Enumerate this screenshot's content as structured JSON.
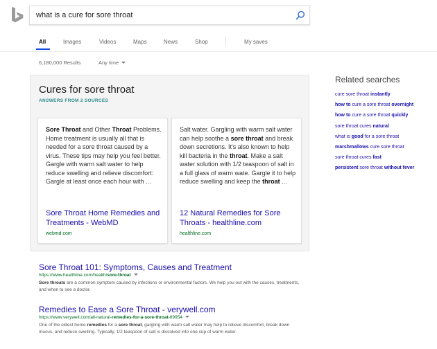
{
  "search": {
    "query": "what is a cure for sore throat"
  },
  "nav": {
    "tabs": [
      {
        "label": "All",
        "active": true
      },
      {
        "label": "Images"
      },
      {
        "label": "Videos"
      },
      {
        "label": "Maps"
      },
      {
        "label": "News"
      },
      {
        "label": "Shop"
      },
      {
        "label": "My saves"
      }
    ]
  },
  "filters": {
    "results_count": "6,180,000 Results",
    "time_filter": "Any time"
  },
  "answer": {
    "title": "Cures for sore throat",
    "sources_label": "ANSWERS FROM 2 SOURCES",
    "cards": [
      {
        "snippet_parts": [
          {
            "text": "Sore Throat",
            "bold": true
          },
          {
            "text": " and Other "
          },
          {
            "text": "Throat",
            "bold": true
          },
          {
            "text": " Problems. Home treatment is usually all that is needed for a sore throat caused by a virus. These tips may help you feel better. Gargle with warm salt water to help reduce swelling and relieve discomfort: Gargle at least once each hour with ..."
          }
        ],
        "title": "Sore Throat Home Remedies and Treatments - WebMD",
        "domain": "webmd.com"
      },
      {
        "snippet_parts": [
          {
            "text": "Salt water. Gargling with warm salt water can help soothe a "
          },
          {
            "text": "sore throat",
            "bold": true
          },
          {
            "text": " and break down secretions. It's also known to help kill bacteria in the "
          },
          {
            "text": "throat",
            "bold": true
          },
          {
            "text": ". Make a salt water solution with 1/2 teaspoon of salt in a full glass of warm wate. Gargle it to help reduce swelling and keep the "
          },
          {
            "text": "throat",
            "bold": true
          },
          {
            "text": " ..."
          }
        ],
        "title": "12 Natural Remedies for Sore Throats - healthline.com",
        "domain": "healthline.com"
      }
    ]
  },
  "results": [
    {
      "title": "Sore Throat 101: Symptoms, Causes and Treatment",
      "url_parts": [
        {
          "text": "https://www.healthline.com/health/"
        },
        {
          "text": "sore-throat",
          "bold": true
        }
      ],
      "snippet_parts": [
        {
          "text": "Sore throats",
          "bold": true
        },
        {
          "text": " are a common symptom caused by infections or environmental factors. We help you out with the causes, treatments, and when to see a doctor."
        }
      ]
    },
    {
      "title": "Remedies to Ease a Sore Throat - verywell.com",
      "url_parts": [
        {
          "text": "https://www.verywell.com/all-natural-"
        },
        {
          "text": "remedies-for-a-sore-throat",
          "bold": true
        },
        {
          "text": "-89954"
        }
      ],
      "snippet_parts": [
        {
          "text": "One of the oldest home "
        },
        {
          "text": "remedies",
          "bold": true
        },
        {
          "text": " for a "
        },
        {
          "text": "sore throat",
          "bold": true
        },
        {
          "text": ", gargling with warm salt water may help to relieve discomfort, break down mucus, and reduce swelling. Typically, 1/2 teaspoon of salt is dissolved into one cup of warm water."
        }
      ]
    }
  ],
  "related": {
    "heading": "Related searches",
    "items": [
      [
        {
          "text": "cure sore throat "
        },
        {
          "text": "instantly",
          "bold": true
        }
      ],
      [
        {
          "text": "how to",
          "bold": true
        },
        {
          "text": " cure a sore throat "
        },
        {
          "text": "overnight",
          "bold": true
        }
      ],
      [
        {
          "text": "how to",
          "bold": true
        },
        {
          "text": " cure a sore throat "
        },
        {
          "text": "quickly",
          "bold": true
        }
      ],
      [
        {
          "text": "sore throat cures "
        },
        {
          "text": "natural",
          "bold": true
        }
      ],
      [
        {
          "text": "what is "
        },
        {
          "text": "good",
          "bold": true
        },
        {
          "text": " for a sore throat"
        }
      ],
      [
        {
          "text": "marshmallows",
          "bold": true
        },
        {
          "text": " cure sore throat"
        }
      ],
      [
        {
          "text": "sore throat cures "
        },
        {
          "text": "fast",
          "bold": true
        }
      ],
      [
        {
          "text": "persistent",
          "bold": true
        },
        {
          "text": " sore throat "
        },
        {
          "text": "without fever",
          "bold": true
        }
      ]
    ]
  },
  "icons": {
    "logo": "bing-logo-icon",
    "search": "magnifier-icon",
    "dropdown": "caret-down-icon"
  },
  "colors": {
    "link": "#1a0dab",
    "url": "#006d21",
    "accent": "#174ae4",
    "source_label": "#2a8a8a"
  }
}
